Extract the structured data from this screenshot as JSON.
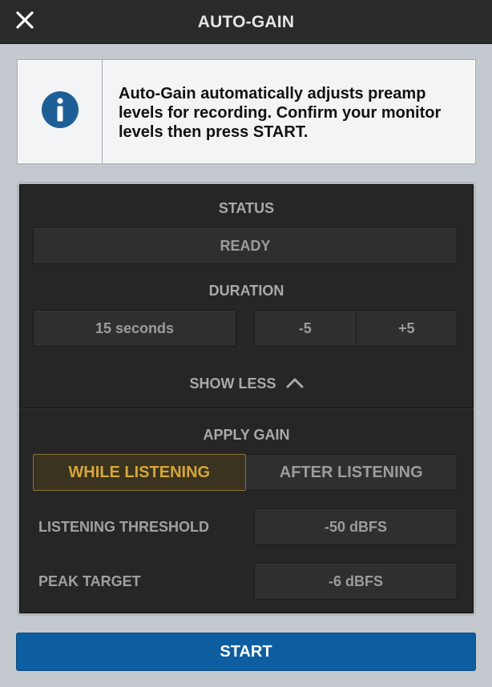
{
  "header": {
    "title": "AUTO-GAIN",
    "close_icon": "close-icon"
  },
  "info": {
    "icon": "info-icon",
    "text": "Auto-Gain automatically adjusts preamp levels for recording. Confirm your monitor levels then press START."
  },
  "status": {
    "label": "STATUS",
    "value": "READY"
  },
  "duration": {
    "label": "DURATION",
    "value": "15 seconds",
    "decrement_label": "-5",
    "increment_label": "+5"
  },
  "toggle": {
    "label": "SHOW LESS",
    "icon": "chevron-up-icon"
  },
  "apply_gain": {
    "label": "APPLY GAIN",
    "options": [
      "WHILE LISTENING",
      "AFTER LISTENING"
    ],
    "selected": "WHILE LISTENING"
  },
  "settings": {
    "listening_threshold": {
      "label": "LISTENING THRESHOLD",
      "value": "-50 dBFS"
    },
    "peak_target": {
      "label": "PEAK TARGET",
      "value": "-6 dBFS"
    }
  },
  "actions": {
    "start_label": "START"
  },
  "colors": {
    "accent_blue": "#0d5ea0",
    "active_gold": "#d6a63a",
    "info_icon_blue": "#1e5f98"
  }
}
